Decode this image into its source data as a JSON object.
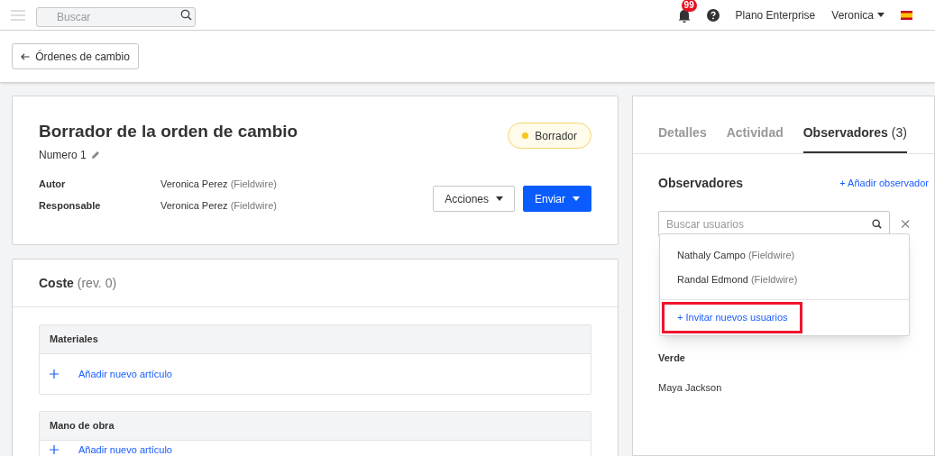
{
  "top_bar": {
    "search": {
      "placeholder": "Buscar"
    },
    "notifications": {
      "count": "99"
    },
    "plan": "Plano Enterprise",
    "user": "Veronica"
  },
  "back_button": {
    "label": "Órdenes de cambio"
  },
  "order": {
    "title": "Borrador de la orden de cambio",
    "number": "Numero 1",
    "status": {
      "label": "Borrador",
      "color": "#f5c518"
    },
    "fields": [
      {
        "label": "Autor",
        "name": "Veronica Perez",
        "company": "(Fieldwire)"
      },
      {
        "label": "Responsable",
        "name": "Veronica Perez",
        "company": "(Fieldwire)"
      }
    ],
    "buttons": [
      {
        "label": "Acciones",
        "kind": "secondary"
      },
      {
        "label": "Enviar",
        "kind": "primary"
      }
    ]
  },
  "cost": {
    "title": "Coste",
    "revision": "(rev. 0)",
    "sections": [
      {
        "title": "Materiales",
        "add_label": "Añadir nuevo artículo"
      },
      {
        "title": "Mano de obra",
        "add_label": "Añadir nuevo artículo"
      }
    ]
  },
  "tabs": [
    {
      "label": "Detalles",
      "selected": false
    },
    {
      "label": "Actividad",
      "selected": false
    },
    {
      "label": "Observadores",
      "count": "(3)",
      "selected": true
    }
  ],
  "observers": {
    "title": "Observadores",
    "add_link": "+ Añadir observador",
    "search": {
      "placeholder": "Buscar usuarios"
    },
    "dropdown": {
      "users": [
        {
          "name": "Nathaly Campo",
          "company": "(Fieldwire)"
        },
        {
          "name": "Randal Edmond",
          "company": "(Fieldwire)"
        }
      ],
      "invite": {
        "label": "+ Invitar nuevos usuarios",
        "highlighted": true
      }
    },
    "groups": [
      {
        "title": "Verde",
        "members": [
          "Maya Jackson"
        ]
      }
    ]
  }
}
